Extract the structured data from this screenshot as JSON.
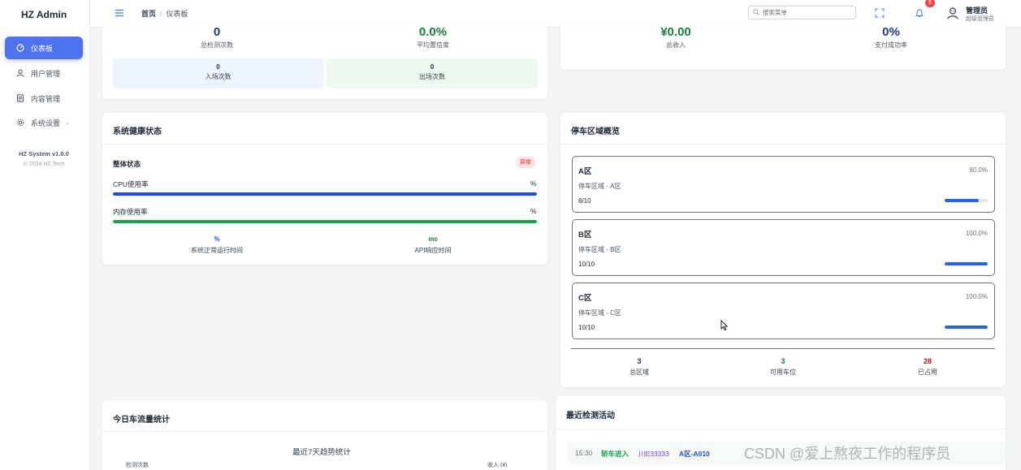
{
  "app": {
    "title": "HZ Admin"
  },
  "sidebar": {
    "items": [
      {
        "label": "仪表板",
        "icon": "dashboard-icon",
        "active": true
      },
      {
        "label": "用户管理",
        "icon": "user-icon"
      },
      {
        "label": "内容管理",
        "icon": "document-icon"
      },
      {
        "label": "系统设置",
        "icon": "gear-icon",
        "has_submenu": true
      }
    ],
    "version": "HZ System v1.0.0",
    "copyright": "© 2024 HZ Tech"
  },
  "header": {
    "breadcrumb": {
      "home": "首页",
      "separator": "/",
      "current": "仪表板"
    },
    "search_placeholder": "搜索菜单",
    "notification_count": "5",
    "user": {
      "name": "管理员",
      "role": "超级管理员"
    }
  },
  "detection_card": {
    "total_value": "0",
    "total_label": "总检测次数",
    "confidence_value": "0.0%",
    "confidence_label": "平均置信度",
    "entry_value": "0",
    "entry_label": "入场次数",
    "exit_value": "0",
    "exit_label": "出场次数"
  },
  "revenue_card": {
    "income_value": "¥0.00",
    "income_label": "总收入",
    "payment_rate_value": "0%",
    "payment_rate_label": "支付成功率"
  },
  "health_card": {
    "title": "系统健康状态",
    "overall_label": "整体状态",
    "overall_status": "异常",
    "cpu_label": "CPU使用率",
    "cpu_value": "%",
    "cpu_fill": 1.0,
    "memory_label": "内存使用率",
    "memory_value": "%",
    "memory_fill": 1.0,
    "uptime_value": "%",
    "uptime_label": "系统正常运行时间",
    "api_value": "ms",
    "api_label": "API响应时间"
  },
  "parking_card": {
    "title": "停车区域概览",
    "zones": [
      {
        "name": "A区",
        "percent": "80.0%",
        "desc": "停车区域 - A区",
        "count": "8/10",
        "fill": 0.8
      },
      {
        "name": "B区",
        "percent": "100.0%",
        "desc": "停车区域 - B区",
        "count": "10/10",
        "fill": 1.0
      },
      {
        "name": "C区",
        "percent": "100.0%",
        "desc": "停车区域 - C区",
        "count": "10/10",
        "fill": 1.0
      }
    ],
    "summary": [
      {
        "value": "3",
        "label": "总区域",
        "color": "#1e3a8a"
      },
      {
        "value": "3",
        "label": "可用车位",
        "color": "#15803d"
      },
      {
        "value": "28",
        "label": "已占用",
        "color": "#b91c1c"
      }
    ]
  },
  "traffic_card": {
    "title": "今日车流量统计",
    "chart_title": "最近7天趋势统计",
    "left_axis_label": "检测次数",
    "right_axis_label": "收入 (¥)"
  },
  "activity_card": {
    "title": "最近检测活动",
    "items": [
      {
        "time": "15:30",
        "event": "轿车进入",
        "plate": "川E33333",
        "zone": "A区-A010"
      }
    ]
  },
  "watermark": "CSDN @爱上熬夜工作的程序员",
  "colors": {
    "accent": "#4f73f0",
    "success": "#16a34a",
    "danger": "#dc2626",
    "primary_bar": "#1d4ed8"
  }
}
